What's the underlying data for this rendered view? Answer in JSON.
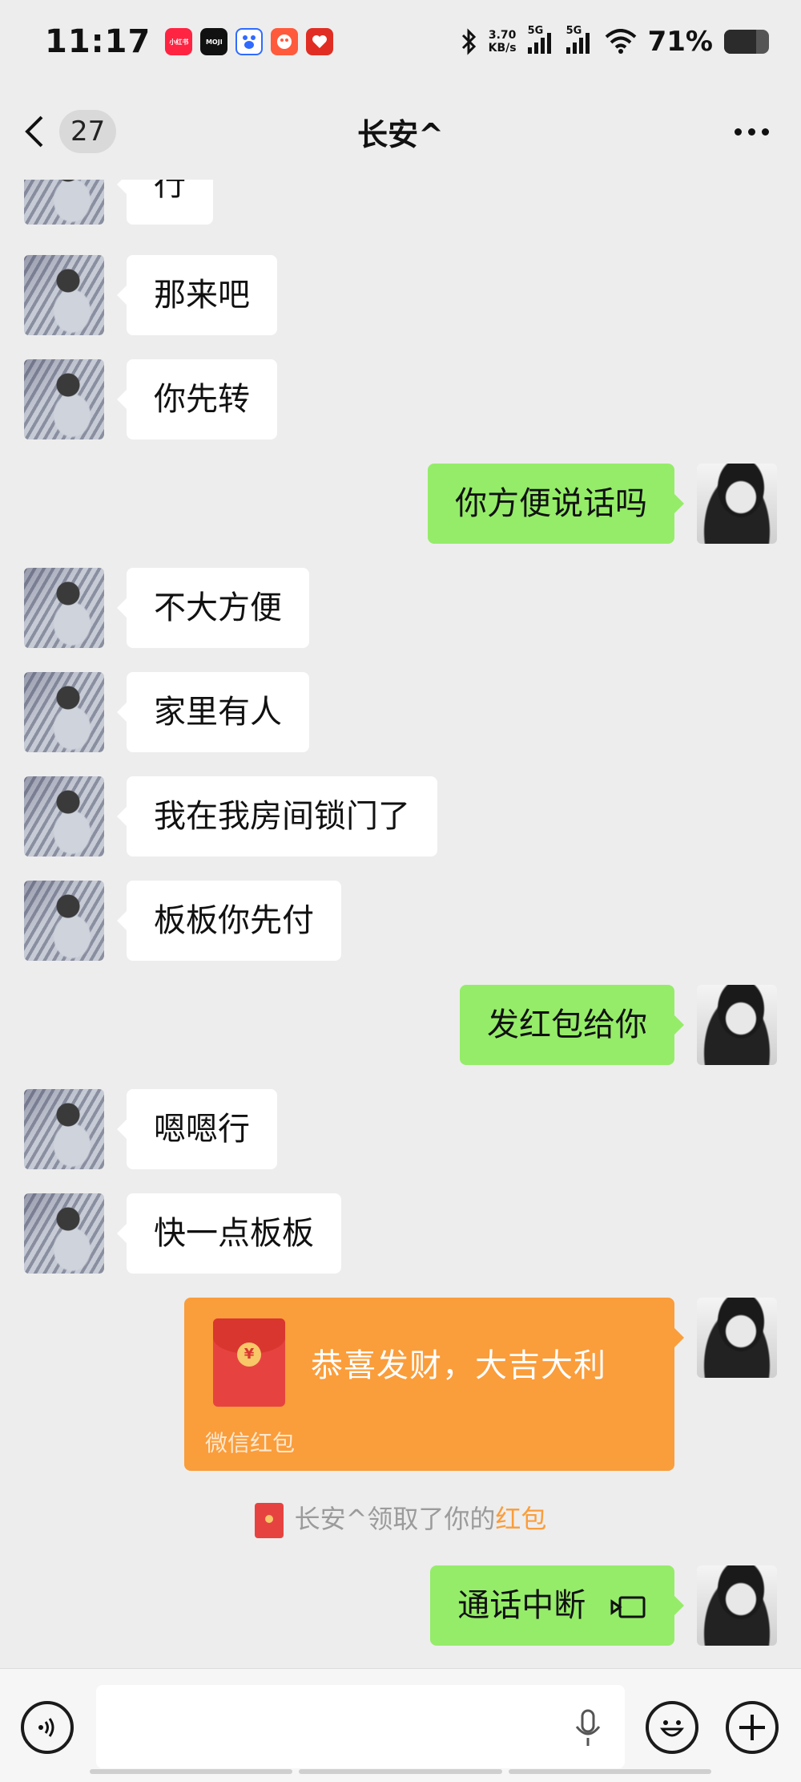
{
  "status_bar": {
    "time": "11:17",
    "app_icons": [
      {
        "name": "xiaohongshu-icon",
        "label": "小红书",
        "color": "#ff2442"
      },
      {
        "name": "moji-icon",
        "label": "MOJI",
        "color": "#111111"
      },
      {
        "name": "baidu-icon",
        "label": "",
        "color": "#2f6bff"
      },
      {
        "name": "game-icon",
        "label": "",
        "color": "#ff5a3c"
      },
      {
        "name": "pinduoduo-icon",
        "label": "",
        "color": "#e02e24"
      }
    ],
    "net_speed_value": "3.70",
    "net_speed_unit": "KB/s",
    "signal1_label": "5G",
    "signal2_label": "5G",
    "battery_percent": "71%",
    "battery_level": 0.71
  },
  "header": {
    "title": "长安^",
    "unread_count": "27"
  },
  "messages": [
    {
      "side": "in",
      "text": "行"
    },
    {
      "side": "in",
      "text": "那来吧"
    },
    {
      "side": "in",
      "text": "你先转"
    },
    {
      "side": "out",
      "text": "你方便说话吗"
    },
    {
      "side": "in",
      "text": "不大方便"
    },
    {
      "side": "in",
      "text": "家里有人"
    },
    {
      "side": "in",
      "text": "我在我房间锁门了"
    },
    {
      "side": "in",
      "text": "板板你先付"
    },
    {
      "side": "out",
      "text": "发红包给你"
    },
    {
      "side": "in",
      "text": "嗯嗯行"
    },
    {
      "side": "in",
      "text": "快一点板板"
    }
  ],
  "red_packet": {
    "greeting": "恭喜发财，大吉大利",
    "label": "微信红包",
    "coin_symbol": "¥"
  },
  "system_note": {
    "prefix": "长安^领取了你的",
    "link": "红包"
  },
  "call_message": {
    "text": "通话中断"
  },
  "colors": {
    "accent_green": "#95ec69",
    "red_packet_orange": "#fa9d3b",
    "background": "#ededed"
  }
}
